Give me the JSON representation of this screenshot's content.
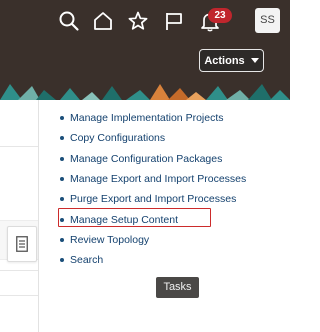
{
  "header": {
    "notification_count": "23",
    "user_initials": "SS",
    "actions_label": "Actions"
  },
  "icons": {
    "search": "search-icon",
    "home": "home-icon",
    "favorites": "star-icon",
    "watchlist": "flag-icon",
    "notifications": "bell-icon",
    "actions_dropdown": "caret-down-icon",
    "document": "document-icon"
  },
  "menu": {
    "items": [
      "Manage Implementation Projects",
      "Copy Configurations",
      "Manage Configuration Packages",
      "Manage Export and Import Processes",
      "Purge Export and Import Processes",
      "Manage Setup Content",
      "Review Topology",
      "Search"
    ],
    "highlighted_index": 5
  },
  "tooltip": {
    "text": "Tasks"
  },
  "colors": {
    "header_bg": "#3a302b",
    "link": "#14416e",
    "badge": "#c0262d",
    "highlight": "#cc2b2b",
    "tooltip_bg": "#4a4846",
    "deco_teal": "#2f8f8a",
    "deco_orange": "#d9823b"
  }
}
